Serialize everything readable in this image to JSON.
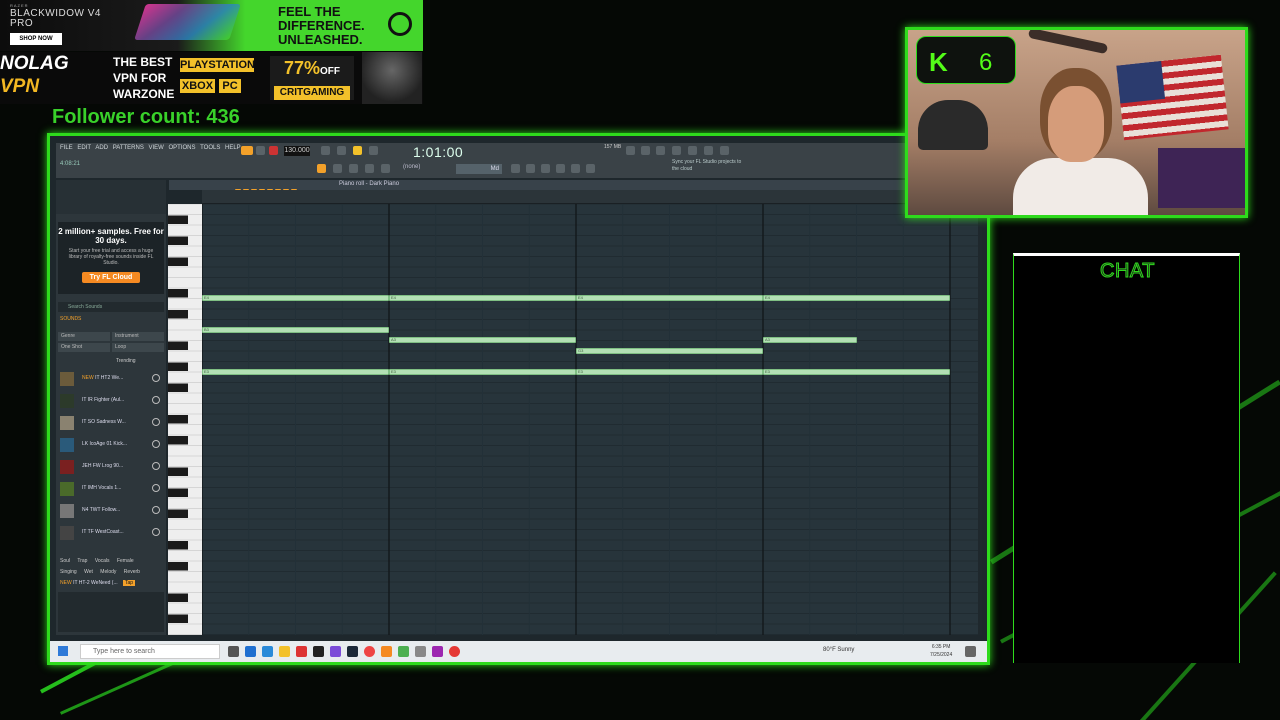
{
  "ads": {
    "razer": {
      "brand": "RAZER",
      "product": "BLACKWIDOW V4 PRO",
      "shop_label": "SHOP NOW",
      "tagline_1": "FEEL THE",
      "tagline_2": "DIFFERENCE.",
      "tagline_3": "UNLEASHED."
    },
    "nolag": {
      "logo_1": "NOLAG",
      "logo_2": "VPN",
      "headline_1": "THE BEST",
      "headline_2": "VPN FOR",
      "headline_3": "WARZONE",
      "platform_1": "PLAYSTATION",
      "platform_2": "XBOX",
      "platform_3": "PC",
      "discount": "77%",
      "discount_suffix": "OFF",
      "code": "CRITGAMING"
    }
  },
  "stream": {
    "follower_count_text": "Follower count: 436",
    "kick_count": "6",
    "chat_title": "CHAT"
  },
  "fl": {
    "menu": [
      "FILE",
      "EDIT",
      "ADD",
      "PATTERNS",
      "VIEW",
      "OPTIONS",
      "TOOLS",
      "HELP"
    ],
    "song_position": "4:08:21",
    "tempo": "130.000",
    "time": "1:01:00",
    "snap": "(none)",
    "pattern": "Md",
    "news": "Sync your FL Studio projects to the cloud",
    "cpu": "157 MB",
    "piano_roll_title": "Piano roll - Dark Piano"
  },
  "browser": {
    "promo_title": "2 million+ samples. Free for 30 days.",
    "promo_sub": "Start your free trial and access a huge library of royalty-free sounds inside FL Studio.",
    "promo_button": "Try FL Cloud",
    "search_placeholder": "Search Sounds",
    "sounds_tab": "SOUNDS",
    "filters": [
      "Genre",
      "Instrument",
      "One Shot",
      "Loop"
    ],
    "sort": "Trending",
    "items": [
      {
        "hot": "NEW",
        "name": "IT HT2 We..."
      },
      {
        "hot": "",
        "name": "IT IR Fighter (Aul..."
      },
      {
        "hot": "",
        "name": "IT SO Sadness W..."
      },
      {
        "hot": "",
        "name": "LK IcoAge 01 Kick..."
      },
      {
        "hot": "",
        "name": "JEH FW Lrog 90..."
      },
      {
        "hot": "",
        "name": "IT IMH Vocals 1..."
      },
      {
        "hot": "",
        "name": "N4 TWT Follow..."
      },
      {
        "hot": "",
        "name": "IT TF WestCoast..."
      }
    ],
    "genres": [
      "Soul",
      "Trap",
      "Vocals",
      "Female",
      "Singing",
      "Wet",
      "Melody",
      "Reverb"
    ],
    "now_playing_tag": "NEW",
    "now_playing": "IT HT-2 WeNeed (...",
    "tap_label": "Tap"
  },
  "piano_roll": {
    "notes": [
      {
        "start": 0.0,
        "length": 1.0,
        "row": 0,
        "label": "E4"
      },
      {
        "start": 1.0,
        "length": 1.0,
        "row": 0,
        "label": "E4"
      },
      {
        "start": 2.0,
        "length": 1.0,
        "row": 0,
        "label": "E4"
      },
      {
        "start": 3.0,
        "length": 1.0,
        "row": 0,
        "label": "E4"
      },
      {
        "start": 0.0,
        "length": 1.0,
        "row": 3,
        "label": "B3"
      },
      {
        "start": 1.0,
        "length": 1.0,
        "row": 4,
        "label": "A3"
      },
      {
        "start": 2.0,
        "length": 1.0,
        "row": 5,
        "label": "G3"
      },
      {
        "start": 3.0,
        "length": 0.5,
        "row": 4,
        "label": "A3"
      },
      {
        "start": 0.0,
        "length": 1.0,
        "row": 7,
        "label": "E3"
      },
      {
        "start": 1.0,
        "length": 1.0,
        "row": 7,
        "label": "E3"
      },
      {
        "start": 2.0,
        "length": 1.0,
        "row": 7,
        "label": "E3"
      },
      {
        "start": 3.0,
        "length": 1.0,
        "row": 7,
        "label": "E3"
      }
    ],
    "bar_count": 4
  },
  "taskbar": {
    "search_placeholder": "Type here to search",
    "weather": "80°F Sunny",
    "time": "6:35 PM",
    "date": "7/25/2024"
  }
}
